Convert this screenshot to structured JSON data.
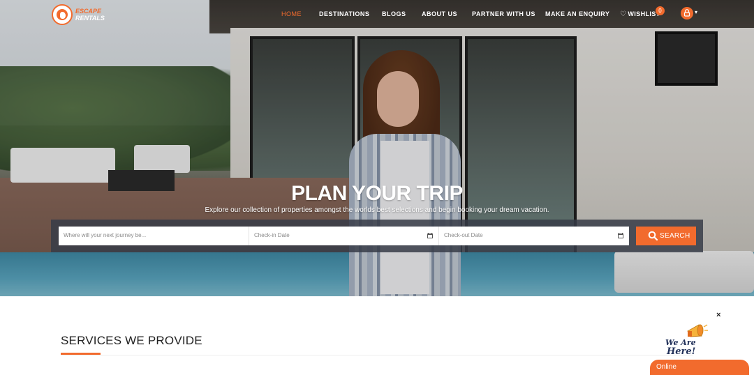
{
  "brand": {
    "logo_line1": "ESCAPE",
    "logo_line2": "RENTALS",
    "accent_color": "#f26b2d"
  },
  "nav": {
    "items": [
      {
        "label": "HOME",
        "active": true
      },
      {
        "label": "DESTINATIONS",
        "active": false
      },
      {
        "label": "BLOGS",
        "active": false
      },
      {
        "label": "ABOUT US",
        "active": false
      },
      {
        "label": "PARTNER WITH US",
        "active": false
      },
      {
        "label": "MAKE AN ENQUIRY",
        "active": false
      }
    ],
    "wishlist_label": "WISHLIST",
    "wishlist_count": "0",
    "user_icon": "user-lock-icon"
  },
  "hero": {
    "title": "PLAN YOUR TRIP",
    "subtitle": "Explore our collection of properties amongst the worlds best selections and begin booking your dream vacation."
  },
  "search": {
    "destination_placeholder": "Where will your next journey be...",
    "checkin_placeholder": "Check-in Date",
    "checkout_placeholder": "Check-out Date",
    "button_label": "SEARCH",
    "calendar_icon": "calendar-icon",
    "button_icon": "search-icon"
  },
  "services": {
    "title": "SERVICES WE PROVIDE"
  },
  "chat": {
    "close_label": "×",
    "promo_line1": "We Are",
    "promo_line2": "Here!",
    "status_label": "Online",
    "icon": "megaphone-icon"
  }
}
